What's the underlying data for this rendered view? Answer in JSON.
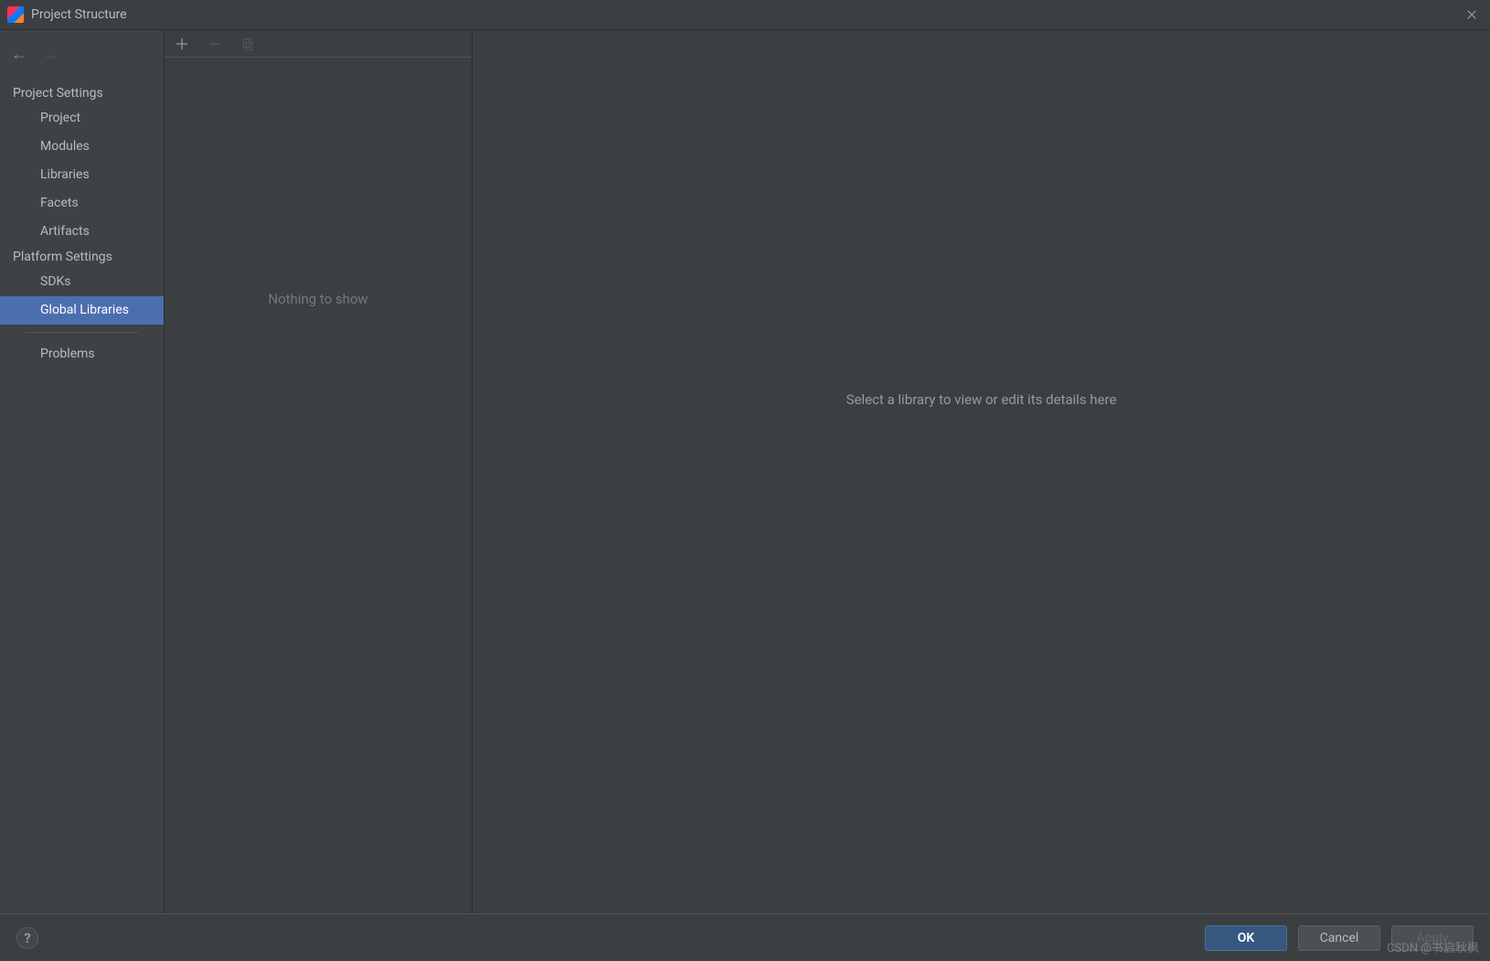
{
  "titlebar": {
    "title": "Project Structure"
  },
  "sidebar": {
    "section1": {
      "header": "Project Settings",
      "items": [
        "Project",
        "Modules",
        "Libraries",
        "Facets",
        "Artifacts"
      ]
    },
    "section2": {
      "header": "Platform Settings",
      "items": [
        "SDKs",
        "Global Libraries"
      ],
      "selected_index": 1
    },
    "section3": {
      "items": [
        "Problems"
      ]
    }
  },
  "middle": {
    "empty_text": "Nothing to show"
  },
  "detail": {
    "empty_text": "Select a library to view or edit its details here"
  },
  "footer": {
    "ok": "OK",
    "cancel": "Cancel",
    "apply": "Apply"
  },
  "watermark": "CSDN @书启秋枫"
}
